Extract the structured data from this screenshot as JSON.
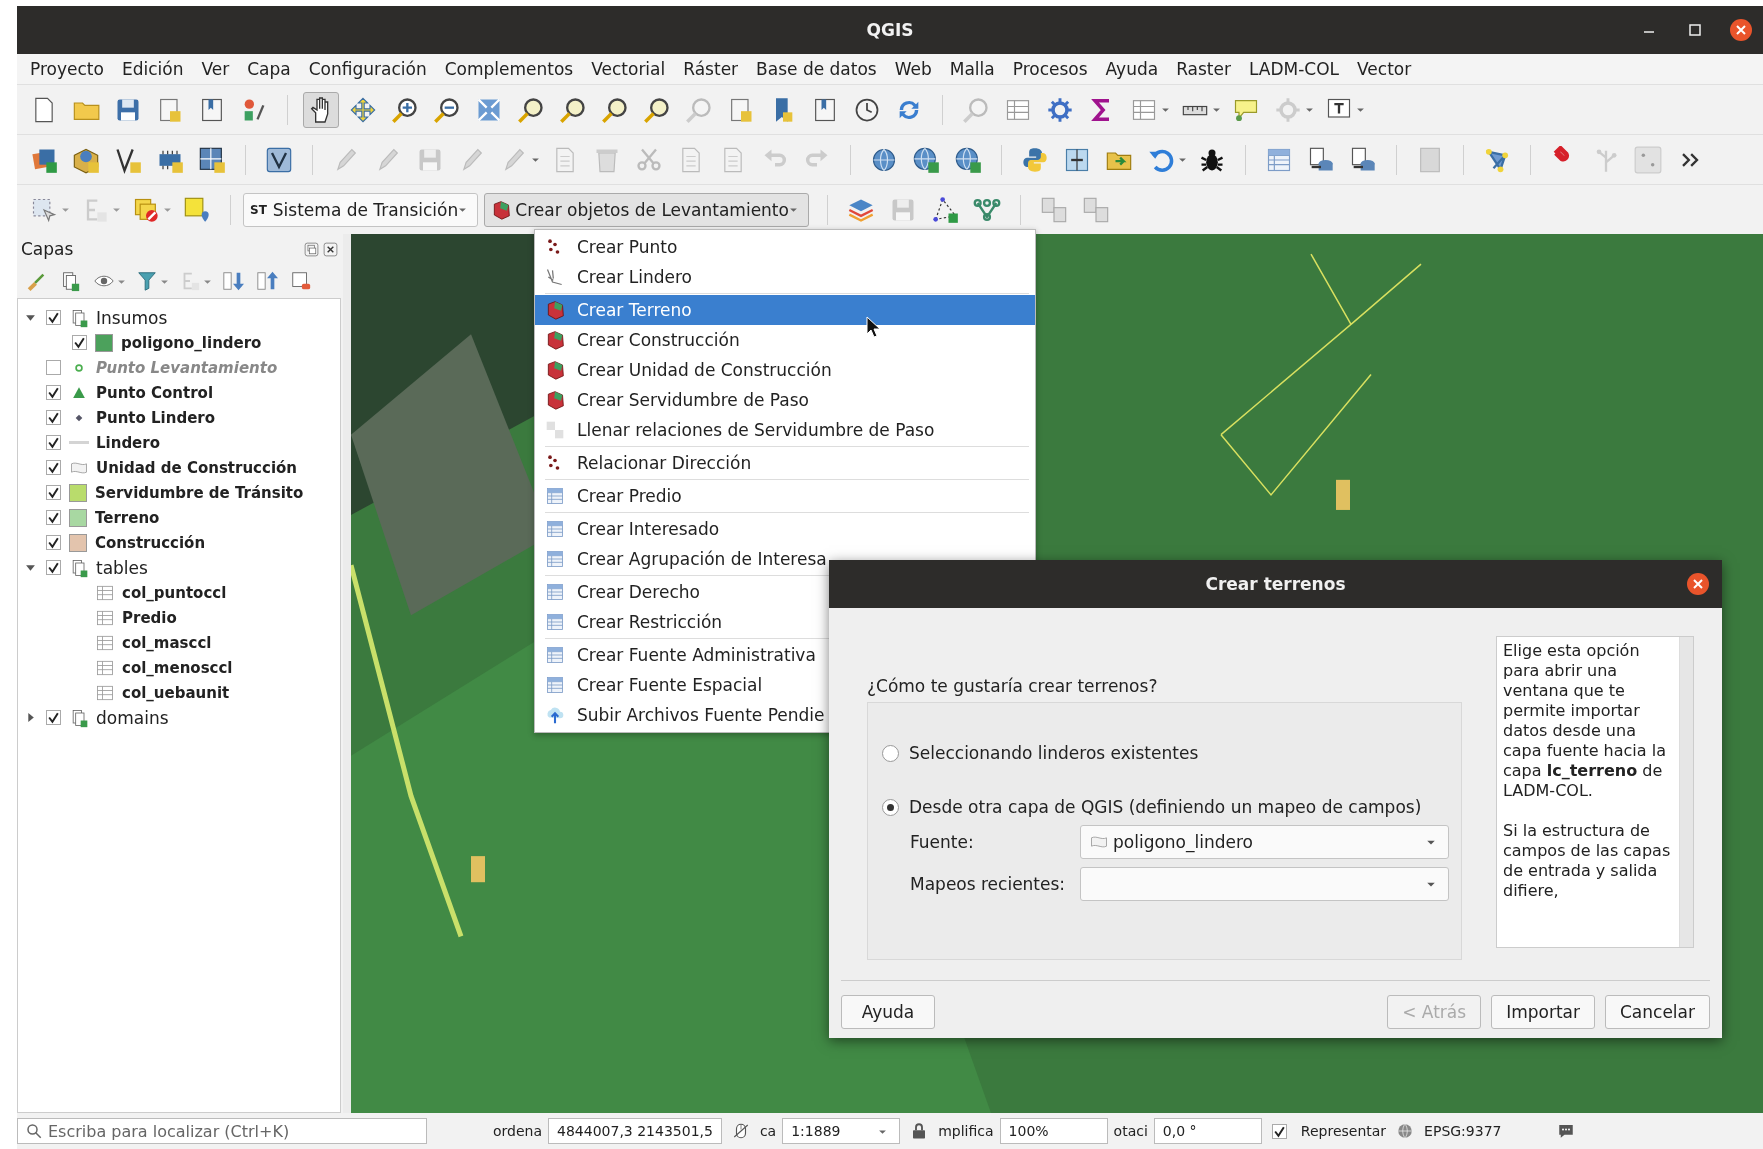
{
  "window": {
    "title": "QGIS"
  },
  "menubar": [
    "Proyecto",
    "Edición",
    "Ver",
    "Capa",
    "Configuración",
    "Complementos",
    "Vectorial",
    "Ráster",
    "Base de datos",
    "Web",
    "Malla",
    "Procesos",
    "Ayuda",
    "Raster",
    "LADM-COL",
    "Vector"
  ],
  "toolbar": {
    "combos": [
      {
        "prefix": "ST",
        "label": "Sistema de Transición",
        "open": false
      },
      {
        "label": "Crear objetos de Levantamiento",
        "open": true
      }
    ]
  },
  "layers_panel": {
    "title": "Capas",
    "tree": [
      {
        "label": "Insumos",
        "kind": "group",
        "checked": true,
        "expanded": true,
        "children": [
          {
            "label": "poligono_lindero",
            "kind": "polygon",
            "color": "#4ca15c",
            "checked": true
          }
        ]
      },
      {
        "label": "Punto Levantamiento",
        "kind": "point",
        "checked": false
      },
      {
        "label": "Punto Control",
        "kind": "triangle",
        "checked": true
      },
      {
        "label": "Punto Lindero",
        "kind": "diamond",
        "checked": true
      },
      {
        "label": "Lindero",
        "kind": "line",
        "checked": true
      },
      {
        "label": "Unidad de Construcción",
        "kind": "outline",
        "checked": true
      },
      {
        "label": "Servidumbre de Tránsito",
        "kind": "polygon",
        "color": "#b9dc6c",
        "checked": true
      },
      {
        "label": "Terreno",
        "kind": "polygon",
        "color": "#a8d8a2",
        "checked": true
      },
      {
        "label": "Construcción",
        "kind": "polygon",
        "color": "#e3c4ad",
        "checked": true
      },
      {
        "label": "tables",
        "kind": "group",
        "checked": true,
        "expanded": true,
        "children": [
          {
            "label": "col_puntoccl",
            "kind": "table"
          },
          {
            "label": "Predio",
            "kind": "table"
          },
          {
            "label": "col_masccl",
            "kind": "table"
          },
          {
            "label": "col_menosccl",
            "kind": "table"
          },
          {
            "label": "col_uebaunit",
            "kind": "table"
          }
        ]
      },
      {
        "label": "domains",
        "kind": "group",
        "checked": true,
        "expanded": false
      }
    ]
  },
  "dropdown_menu": {
    "groups": [
      [
        {
          "label": "Crear Punto",
          "kind": "points",
          "selected": false
        },
        {
          "label": "Crear Lindero",
          "kind": "line",
          "selected": false
        }
      ],
      [
        {
          "label": "Crear Terreno",
          "kind": "polygon",
          "selected": true
        },
        {
          "label": "Crear Construcción",
          "kind": "polygon",
          "selected": false
        },
        {
          "label": "Crear Unidad de Construcción",
          "kind": "polygon",
          "selected": false
        },
        {
          "label": "Crear Servidumbre de Paso",
          "kind": "polygon",
          "selected": false
        },
        {
          "label": "Llenar relaciones de Servidumbre de Paso",
          "kind": "relation",
          "selected": false
        }
      ],
      [
        {
          "label": "Relacionar Dirección",
          "kind": "points",
          "selected": false
        }
      ],
      [
        {
          "label": "Crear Predio",
          "kind": "table",
          "selected": false
        }
      ],
      [
        {
          "label": "Crear Interesado",
          "kind": "table",
          "selected": false
        },
        {
          "label": "Crear Agrupación de Interesa",
          "kind": "table",
          "selected": false
        }
      ],
      [
        {
          "label": "Crear Derecho",
          "kind": "table",
          "selected": false
        },
        {
          "label": "Crear Restricción",
          "kind": "table",
          "selected": false
        }
      ],
      [
        {
          "label": "Crear Fuente Administrativa",
          "kind": "table",
          "selected": false
        },
        {
          "label": "Crear Fuente Espacial",
          "kind": "table",
          "selected": false
        },
        {
          "label": "Subir Archivos Fuente Pendie",
          "kind": "upload",
          "selected": false
        }
      ]
    ]
  },
  "dialog": {
    "title": "Crear terrenos",
    "question": "¿Cómo te gustaría crear terrenos?",
    "options": [
      {
        "label": "Seleccionando linderos existentes",
        "selected": false
      },
      {
        "label": "Desde otra capa de QGIS (definiendo un mapeo de campos)",
        "selected": true
      }
    ],
    "fields": [
      {
        "label": "Fuente:",
        "value": "poligono_lindero"
      },
      {
        "label": "Mapeos recientes:"
      }
    ],
    "help": [
      "Elige esta opción para abrir una ventana que te permite importar datos desde una capa fuente hacia la capa **lc_terreno** de LADM-COL.",
      "Si la estructura de campos de las capas de entrada y salida difiere,"
    ],
    "buttons": [
      {
        "label": "Ayuda",
        "disabled": false
      },
      {
        "label": "< Atrás",
        "disabled": true
      },
      {
        "label": "Importar",
        "disabled": false
      },
      {
        "label": "Cancelar",
        "disabled": false
      }
    ]
  },
  "status_bar": {
    "search_placeholder": "Escriba para localizar (Ctrl+K)",
    "coordinate_label": "ordena",
    "coordinate": "4844007,3 2143501,5",
    "scale_label": "ca",
    "scale": "1:1889",
    "magnifier_label": "mplifica",
    "magnifier": "100%",
    "rotation_label": "otaci",
    "rotation": "0,0 °",
    "render": {
      "label": "Representar",
      "checked": true
    },
    "crs": "EPSG:9377"
  }
}
